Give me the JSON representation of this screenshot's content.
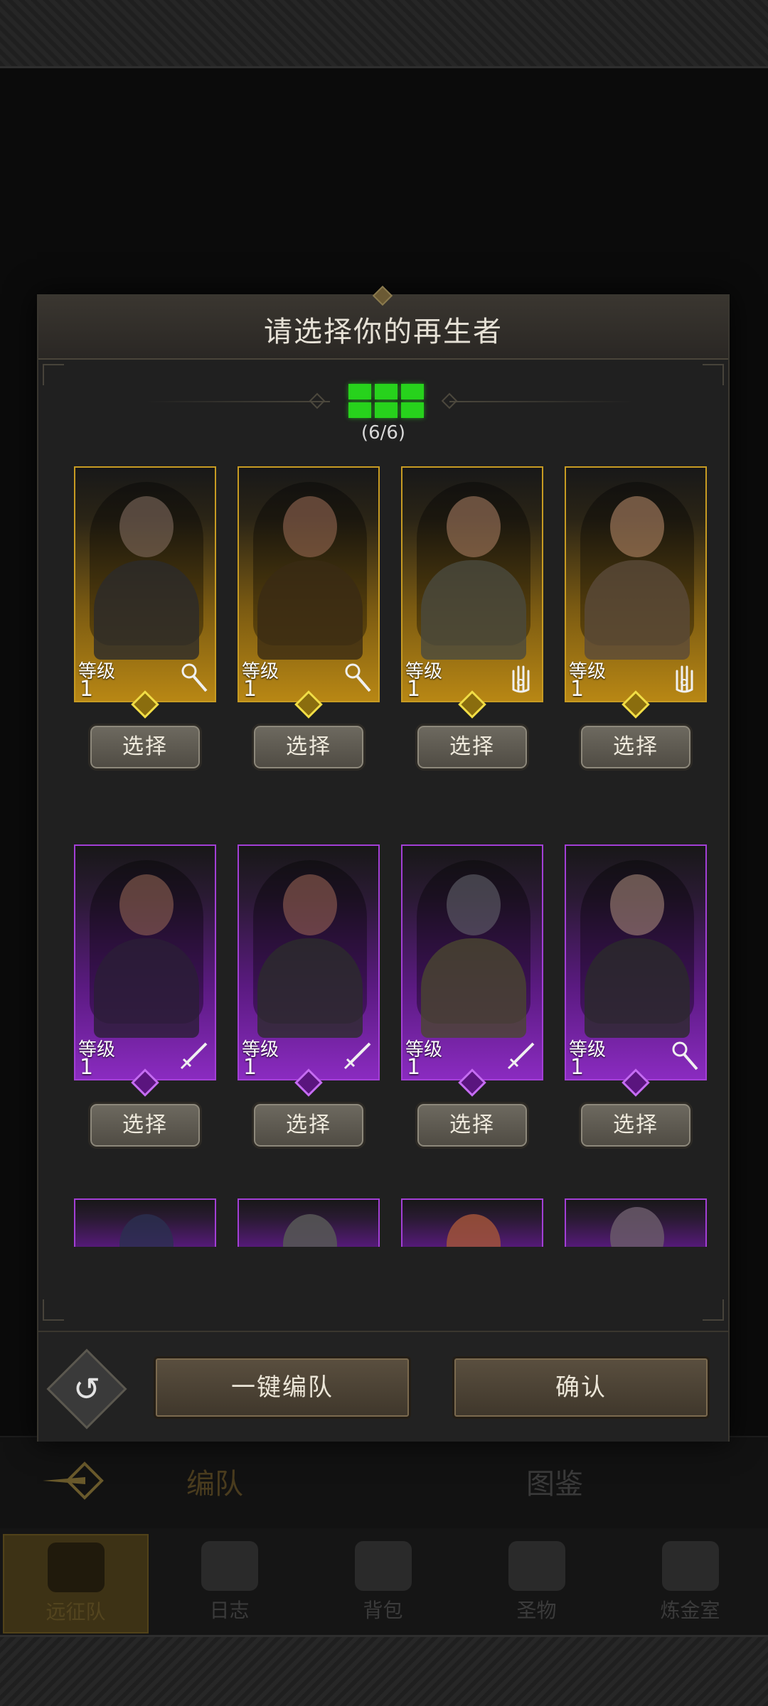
{
  "modal": {
    "title": "请选择你的再生者",
    "counter": "(6/6)",
    "slots_filled": 6,
    "slots_total": 6,
    "level_label": "等级",
    "select_label": "选择"
  },
  "heroes": [
    {
      "rarity": "gold",
      "level": "1",
      "class_icon": "staff-icon"
    },
    {
      "rarity": "gold",
      "level": "1",
      "class_icon": "staff-icon"
    },
    {
      "rarity": "gold",
      "level": "1",
      "class_icon": "hand-icon"
    },
    {
      "rarity": "gold",
      "level": "1",
      "class_icon": "hand-icon"
    },
    {
      "rarity": "purple",
      "level": "1",
      "class_icon": "sword-icon"
    },
    {
      "rarity": "purple",
      "level": "1",
      "class_icon": "sword-icon"
    },
    {
      "rarity": "purple",
      "level": "1",
      "class_icon": "sword-icon"
    },
    {
      "rarity": "purple",
      "level": "1",
      "class_icon": "staff-icon"
    }
  ],
  "footer": {
    "auto_label": "一键编队",
    "confirm_label": "确认"
  },
  "background": {
    "tab_formation": "编队",
    "tab_codex": "图鉴",
    "nav": [
      "远征队",
      "日志",
      "背包",
      "圣物",
      "炼金室"
    ]
  },
  "colors": {
    "slot_green": "#27d21c",
    "gold_rarity": "#c79b22",
    "purple_rarity": "#a33fd6"
  }
}
